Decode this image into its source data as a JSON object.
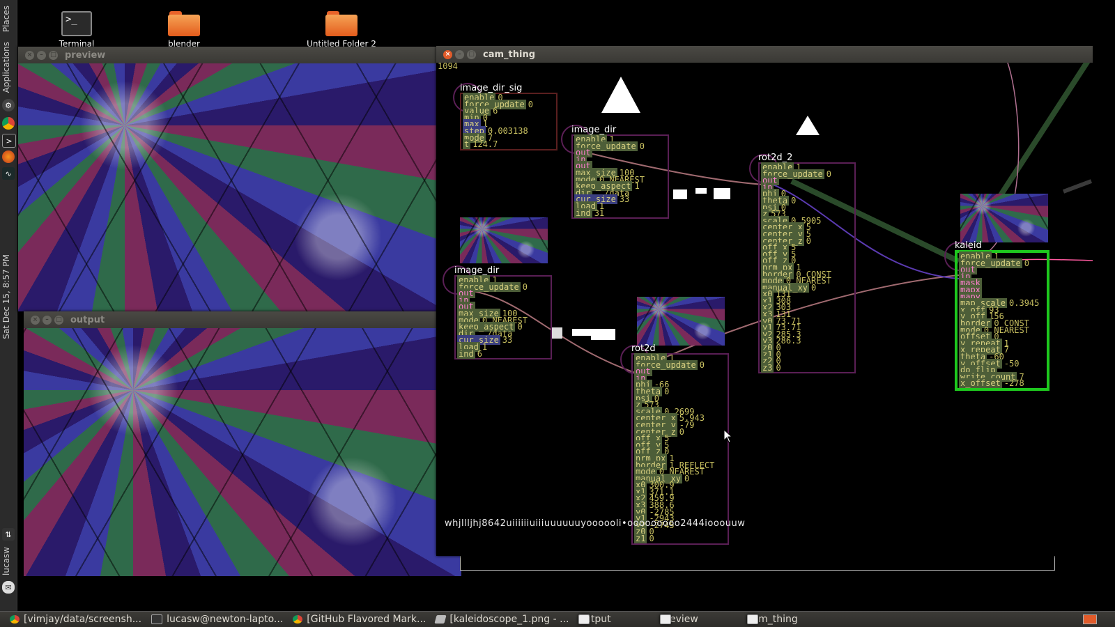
{
  "launcher": {
    "top_label": "Places",
    "top_label2": "Applications",
    "clock": "Sat Dec 15,  8:57 PM",
    "user": "lucasw"
  },
  "desktop": {
    "icons": [
      {
        "label": "Terminal",
        "icon": "terminal-icon"
      },
      {
        "label": "blender",
        "icon": "folder-icon"
      },
      {
        "label": "Untitled Folder 2",
        "icon": "folder-icon"
      }
    ]
  },
  "windows": {
    "preview": {
      "title": "preview"
    },
    "output": {
      "title": "output"
    },
    "cam_thing": {
      "title": "cam_thing"
    }
  },
  "cam": {
    "top_number": "1094",
    "bottom_text": "whjllljhj8642uiiiiiiuiiiuuuuuuyoooooli•ooooooooo2444iooouuw",
    "nodes": {
      "image_dir_sig": {
        "title": "image_dir_sig",
        "rows": [
          [
            "enable",
            "0"
          ],
          [
            "force_update",
            "0"
          ],
          [
            "value",
            "6"
          ],
          [
            "min",
            "0"
          ],
          [
            "max",
            "1"
          ],
          [
            "step",
            "0.003138"
          ],
          [
            "mode",
            "7"
          ],
          [
            "t",
            "124.7"
          ]
        ]
      },
      "image_dir_a": {
        "title": "image_dir",
        "rows": [
          [
            "enable",
            "1"
          ],
          [
            "force_update",
            "0"
          ],
          [
            "out",
            ""
          ],
          [
            "in",
            ""
          ],
          [
            "out",
            ""
          ],
          [
            "max_size",
            "100"
          ],
          [
            "mode",
            "0 NEAREST"
          ],
          [
            "keep_aspect",
            "1"
          ],
          [
            "dir",
            "../data"
          ],
          [
            "cur_size",
            "33"
          ],
          [
            "load",
            "1"
          ],
          [
            "ind",
            "31"
          ]
        ]
      },
      "image_dir_b": {
        "title": "image_dir",
        "rows": [
          [
            "enable",
            "1"
          ],
          [
            "force_update",
            "0"
          ],
          [
            "out",
            ""
          ],
          [
            "in",
            ""
          ],
          [
            "out",
            ""
          ],
          [
            "max_size",
            "100"
          ],
          [
            "mode",
            "0 NEAREST"
          ],
          [
            "keep_aspect",
            "0"
          ],
          [
            "dir",
            "../data"
          ],
          [
            "cur_size",
            "33"
          ],
          [
            "load",
            "1"
          ],
          [
            "ind",
            "6"
          ]
        ]
      },
      "rot2d_2": {
        "title": "rot2d_2",
        "rows": [
          [
            "enable",
            "1"
          ],
          [
            "force_update",
            "0"
          ],
          [
            "out",
            ""
          ],
          [
            "in",
            ""
          ],
          [
            "phi",
            "0"
          ],
          [
            "theta",
            "0"
          ],
          [
            "psi",
            "0"
          ],
          [
            "z",
            "573"
          ],
          [
            "scale",
            "0.5905"
          ],
          [
            "center_x",
            "5"
          ],
          [
            "center_y",
            "5"
          ],
          [
            "center_z",
            "0"
          ],
          [
            "off_x",
            "5"
          ],
          [
            "off_y",
            "5"
          ],
          [
            "off_z",
            "0"
          ],
          [
            "nrm_px",
            "1"
          ],
          [
            "border",
            "0 CONST"
          ],
          [
            "mode",
            "0 NEAREST"
          ],
          [
            "manual_xy",
            "0"
          ],
          [
            "x0",
            "131"
          ],
          [
            "x1",
            "308"
          ],
          [
            "x2",
            "303"
          ],
          [
            "x3",
            "131"
          ],
          [
            "y0",
            "73.71"
          ],
          [
            "y1",
            "73.71"
          ],
          [
            "y2",
            "285.3"
          ],
          [
            "y3",
            "286.3"
          ],
          [
            "z0",
            "0"
          ],
          [
            "z1",
            "0"
          ],
          [
            "z2",
            "0"
          ],
          [
            "z3",
            "0"
          ]
        ]
      },
      "rot2d": {
        "title": "rot2d",
        "rows": [
          [
            "enable",
            "1"
          ],
          [
            "force_update",
            "0"
          ],
          [
            "out",
            ""
          ],
          [
            "in",
            ""
          ],
          [
            "phi",
            "-66"
          ],
          [
            "theta",
            "0"
          ],
          [
            "psi",
            "0"
          ],
          [
            "z",
            "573"
          ],
          [
            "scale",
            "0.2699"
          ],
          [
            "center_x",
            "5.943"
          ],
          [
            "center_y",
            "-79"
          ],
          [
            "center_z",
            "0"
          ],
          [
            "off_x",
            "5"
          ],
          [
            "off_y",
            "5"
          ],
          [
            "off_z",
            "0"
          ],
          [
            "nrm_px",
            "1"
          ],
          [
            "border",
            "1 REFLECT"
          ],
          [
            "mode",
            "0 NEAREST"
          ],
          [
            "manual_xy",
            "0"
          ],
          [
            "x0",
            "300.9"
          ],
          [
            "x1",
            "371.1"
          ],
          [
            "x2",
            "459.9"
          ],
          [
            "x3",
            "388.6"
          ],
          [
            "y0",
            "-2785"
          ],
          [
            "y1",
            "-2943"
          ],
          [
            "y2",
            "-2745"
          ],
          [
            "z0",
            "0"
          ],
          [
            "z1",
            "0"
          ]
        ]
      },
      "kaleid": {
        "title": "kaleid",
        "rows": [
          [
            "enable",
            "1"
          ],
          [
            "force_update",
            "0"
          ],
          [
            "out",
            ""
          ],
          [
            "in",
            ""
          ],
          [
            "mask",
            ""
          ],
          [
            "mapx",
            ""
          ],
          [
            "mapy",
            ""
          ],
          [
            "map_scale",
            "0.3945"
          ],
          [
            "x_off",
            "93"
          ],
          [
            "y_off",
            "156"
          ],
          [
            "border",
            "0 CONST"
          ],
          [
            "mode",
            "0 NEAREST"
          ],
          [
            "offset",
            "0"
          ],
          [
            "y_repeat",
            "1"
          ],
          [
            "x_repeat",
            "7"
          ],
          [
            "theta",
            "-60"
          ],
          [
            "y_offset",
            "-50"
          ],
          [
            "do_flip",
            ""
          ],
          [
            "write_count",
            "7"
          ],
          [
            "x_offset",
            "-278"
          ]
        ]
      }
    }
  },
  "taskbar": {
    "items": [
      {
        "label": "[vimjay/data/screensh...",
        "icon": "chrome-icon"
      },
      {
        "label": "lucasw@newton-lapto...",
        "icon": "terminal-icon"
      },
      {
        "label": "[GitHub Flavored Mark...",
        "icon": "chrome-icon"
      },
      {
        "label": "[kaleidoscope_1.png - ...",
        "icon": "image-viewer-icon"
      },
      {
        "label": "output",
        "icon": "window-icon"
      },
      {
        "label": "preview",
        "icon": "window-icon"
      },
      {
        "label": "cam_thing",
        "icon": "window-icon"
      }
    ]
  }
}
